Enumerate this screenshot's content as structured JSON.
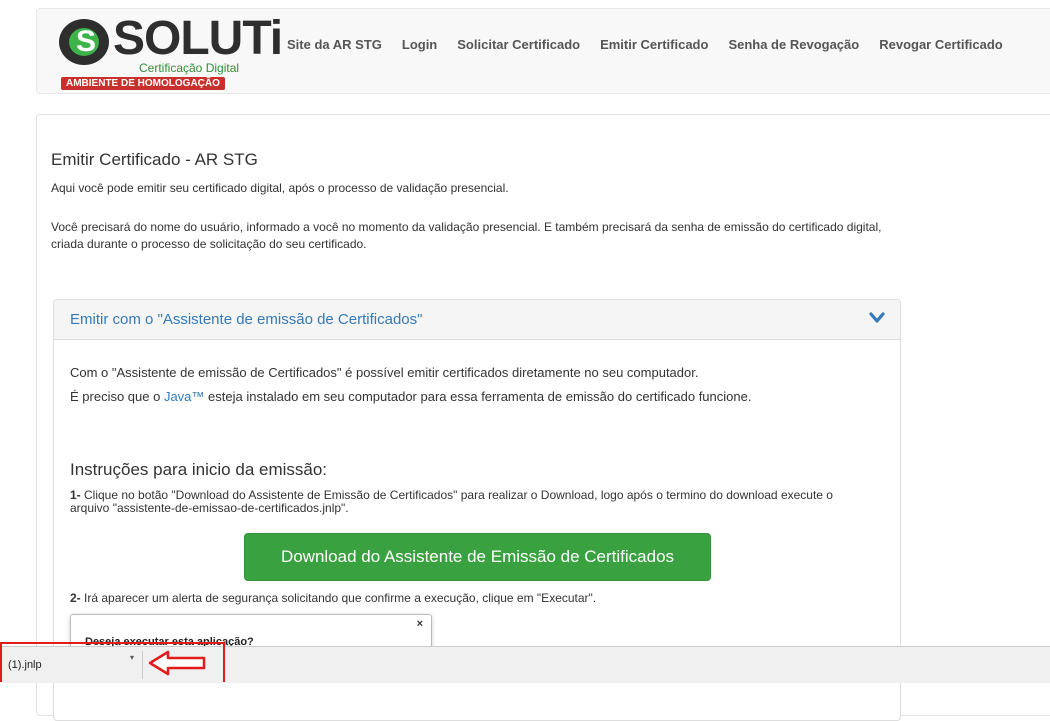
{
  "brand": {
    "logo_letter": "S",
    "logo_text": "SOLUTi",
    "logo_sub": "Certificação Digital",
    "env_badge": "AMBIENTE DE HOMOLOGAÇÃO",
    "accent_green": "#3cb44a",
    "badge_red": "#c9302c"
  },
  "nav": {
    "items": [
      {
        "label": "Site da AR STG"
      },
      {
        "label": "Login"
      },
      {
        "label": "Solicitar Certificado"
      },
      {
        "label": "Emitir Certificado"
      },
      {
        "label": "Senha de Revogação"
      },
      {
        "label": "Revogar Certificado"
      }
    ]
  },
  "main": {
    "title": "Emitir Certificado - AR STG",
    "intro1": "Aqui você pode emitir seu certificado digital, após o processo de validação presencial.",
    "intro2": "Você precisará do nome do usuário, informado a você no momento da validação presencial. E também precisará da senha de emissão do certificado digital, criada durante o processo de solicitação do seu certificado."
  },
  "accordion": {
    "title": "Emitir com o \"Assistente de emissão de Certificados\"",
    "chevron_icon": "chevron-down-icon",
    "p1": "Com o \"Assistente de emissão de Certificados\" é possível emitir certificados diretamente no seu computador.",
    "p2_before": "É preciso que o ",
    "p2_link": "Java™",
    "p2_after": " esteja instalado em seu computador para essa ferramenta de emissão do certificado funcione.",
    "instructions_title": "Instruções para inicio da emissão:",
    "step1_num": "1-",
    "step1_text": " Clique no botão \"Download do Assistente de Emissão de Certificados\" para realizar o Download, logo após o termino do download execute o arquivo \"assistente-de-emissao-de-certificados.jnlp\".",
    "download_button": "Download do Assistente de Emissão de Certificados",
    "step2_num": "2-",
    "step2_text": " Irá aparecer um alerta de segurança solicitando que confirme a execução, clique em \"Executar\".",
    "dialog_close": "×",
    "dialog_title": "Deseja executar esta aplicação?"
  },
  "download_bar": {
    "file_name": "(1).jnlp",
    "menu_arrow": "▾"
  },
  "annotation": {
    "color": "#e21b1b"
  }
}
